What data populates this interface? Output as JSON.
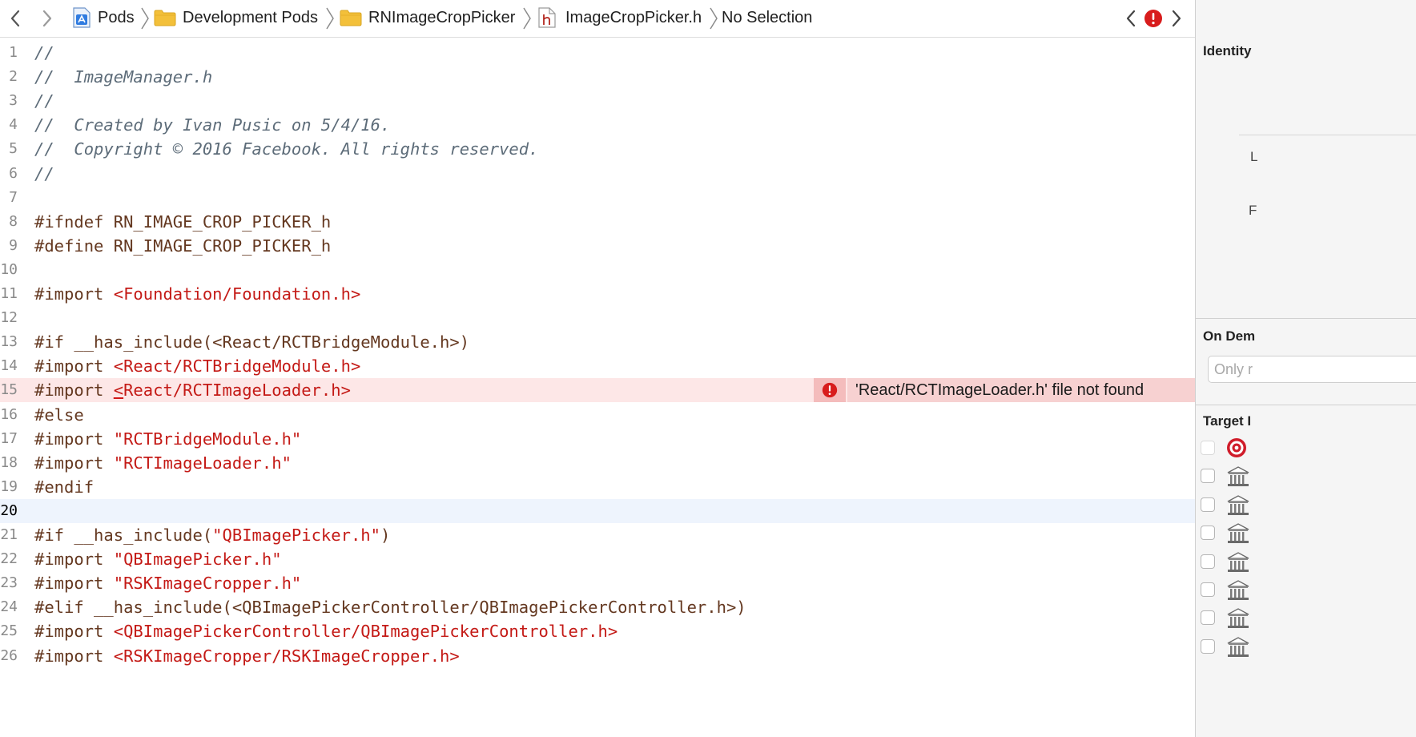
{
  "breadcrumb": [
    {
      "label": "Pods",
      "icon": "xcode-project-icon"
    },
    {
      "label": "Development Pods",
      "icon": "folder-icon"
    },
    {
      "label": "RNImageCropPicker",
      "icon": "folder-icon"
    },
    {
      "label": "ImageCropPicker.h",
      "icon": "header-file-icon"
    },
    {
      "label": "No Selection",
      "icon": ""
    }
  ],
  "colors": {
    "error": "#d81c1c",
    "comment": "#5d6c79",
    "preprocessor": "#643820",
    "string": "#c41a16",
    "error_line_bg": "#fde7e7",
    "current_line_bg": "#eef4fd"
  },
  "editor": {
    "current_line": 20,
    "error_line": 15,
    "error_message": "'React/RCTImageLoader.h' file not found",
    "lines": [
      {
        "n": "1",
        "segs": [
          {
            "t": "//",
            "c": "cm"
          }
        ]
      },
      {
        "n": "2",
        "segs": [
          {
            "t": "//  ImageManager.h",
            "c": "cm"
          }
        ]
      },
      {
        "n": "3",
        "segs": [
          {
            "t": "//",
            "c": "cm"
          }
        ]
      },
      {
        "n": "4",
        "segs": [
          {
            "t": "//  Created by Ivan Pusic on 5/4/16.",
            "c": "cm"
          }
        ]
      },
      {
        "n": "5",
        "segs": [
          {
            "t": "//  Copyright © 2016 Facebook. All rights reserved.",
            "c": "cm"
          }
        ]
      },
      {
        "n": "6",
        "segs": [
          {
            "t": "//",
            "c": "cm"
          }
        ]
      },
      {
        "n": "7",
        "segs": []
      },
      {
        "n": "8",
        "segs": [
          {
            "t": "#ifndef RN_IMAGE_CROP_PICKER_h",
            "c": "pp"
          }
        ]
      },
      {
        "n": "9",
        "segs": [
          {
            "t": "#define RN_IMAGE_CROP_PICKER_h",
            "c": "pp"
          }
        ]
      },
      {
        "n": "10",
        "segs": []
      },
      {
        "n": "11",
        "segs": [
          {
            "t": "#import ",
            "c": "pp"
          },
          {
            "t": "<Foundation/Foundation.h>",
            "c": "st"
          }
        ]
      },
      {
        "n": "12",
        "segs": []
      },
      {
        "n": "13",
        "segs": [
          {
            "t": "#if __has_include(<React/RCTBridgeModule.h>)",
            "c": "pp"
          }
        ]
      },
      {
        "n": "14",
        "segs": [
          {
            "t": "#import ",
            "c": "pp"
          },
          {
            "t": "<React/RCTBridgeModule.h>",
            "c": "st"
          }
        ]
      },
      {
        "n": "15",
        "segs": [
          {
            "t": "#import ",
            "c": "pp"
          },
          {
            "t": "<",
            "c": "st caret-u"
          },
          {
            "t": "React/RCTImageLoader.h>",
            "c": "st"
          }
        ]
      },
      {
        "n": "16",
        "segs": [
          {
            "t": "#else",
            "c": "pp"
          }
        ]
      },
      {
        "n": "17",
        "segs": [
          {
            "t": "#import ",
            "c": "pp"
          },
          {
            "t": "\"RCTBridgeModule.h\"",
            "c": "st"
          }
        ]
      },
      {
        "n": "18",
        "segs": [
          {
            "t": "#import ",
            "c": "pp"
          },
          {
            "t": "\"RCTImageLoader.h\"",
            "c": "st"
          }
        ]
      },
      {
        "n": "19",
        "segs": [
          {
            "t": "#endif",
            "c": "pp"
          }
        ]
      },
      {
        "n": "20",
        "segs": []
      },
      {
        "n": "21",
        "segs": [
          {
            "t": "#if __has_include(",
            "c": "pp"
          },
          {
            "t": "\"QBImagePicker.h\"",
            "c": "st"
          },
          {
            "t": ")",
            "c": "pp"
          }
        ]
      },
      {
        "n": "22",
        "segs": [
          {
            "t": "#import ",
            "c": "pp"
          },
          {
            "t": "\"QBImagePicker.h\"",
            "c": "st"
          }
        ]
      },
      {
        "n": "23",
        "segs": [
          {
            "t": "#import ",
            "c": "pp"
          },
          {
            "t": "\"RSKImageCropper.h\"",
            "c": "st"
          }
        ]
      },
      {
        "n": "24",
        "segs": [
          {
            "t": "#elif __has_include(<QBImagePickerController/QBImagePickerController.h>)",
            "c": "pp"
          }
        ]
      },
      {
        "n": "25",
        "segs": [
          {
            "t": "#import ",
            "c": "pp"
          },
          {
            "t": "<QBImagePickerController/QBImagePickerController.h>",
            "c": "st"
          }
        ]
      },
      {
        "n": "26",
        "segs": [
          {
            "t": "#import ",
            "c": "pp"
          },
          {
            "t": "<RSKImageCropper/RSKImageCropper.h>",
            "c": "st"
          }
        ]
      }
    ]
  },
  "inspector": {
    "identity_title": "Identity",
    "label_l": "L",
    "label_f": "F",
    "on_demand_title": "On Dem",
    "on_demand_placeholder": "Only r",
    "target_title": "Target I",
    "targets": [
      {
        "icon": "target-icon"
      },
      {
        "icon": "library-icon"
      },
      {
        "icon": "library-icon"
      },
      {
        "icon": "library-icon"
      },
      {
        "icon": "library-icon"
      },
      {
        "icon": "library-icon"
      },
      {
        "icon": "library-icon"
      },
      {
        "icon": "library-icon"
      }
    ]
  }
}
